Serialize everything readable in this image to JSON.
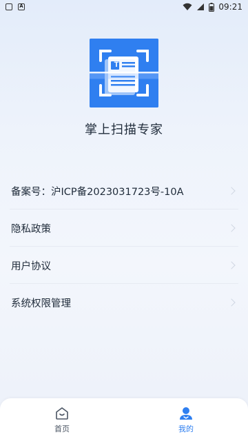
{
  "status_bar": {
    "time": "09:21",
    "left_icons": [
      "notification-icon",
      "a-icon"
    ],
    "right_icons": [
      "wifi-icon",
      "signal-icon",
      "battery-icon"
    ]
  },
  "app": {
    "name": "掌上扫描专家",
    "logo_letter": "T",
    "brand_color": "#2f7ff0"
  },
  "menu": {
    "items": [
      {
        "label": "备案号：沪ICP备2023031723号-10A"
      },
      {
        "label": "隐私政策"
      },
      {
        "label": "用户协议"
      },
      {
        "label": "系统权限管理"
      }
    ]
  },
  "bottom_nav": {
    "items": [
      {
        "label": "首页",
        "icon": "home-icon",
        "active": false
      },
      {
        "label": "我的",
        "icon": "user-icon",
        "active": true
      }
    ]
  }
}
